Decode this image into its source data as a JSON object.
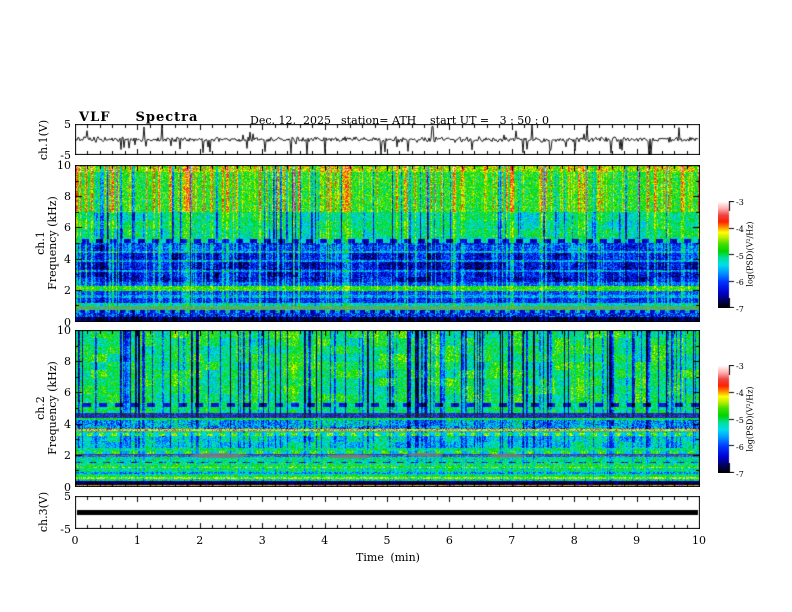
{
  "header": {
    "title": "VLF  Spectra",
    "date": "Dec. 12,  2025",
    "station": "station= ATH",
    "start_ut": "start UT =   3 : 50 : 0"
  },
  "time_axis": {
    "label": "Time  (min)",
    "range": [
      0,
      10
    ],
    "ticks": [
      "0",
      "1",
      "2",
      "3",
      "4",
      "5",
      "6",
      "7",
      "8",
      "9",
      "10"
    ],
    "minor_ticks_per_major": 5
  },
  "colorbar": {
    "label": "log(PSD)(V²/Hz)",
    "ticks": [
      "-3",
      "-4",
      "-5",
      "-6",
      "-7"
    ],
    "vmin": -7,
    "vmax": -3,
    "stops": [
      [
        0,
        "#000000"
      ],
      [
        0.05,
        "#000046"
      ],
      [
        0.14,
        "#0000cd"
      ],
      [
        0.24,
        "#0033ff"
      ],
      [
        0.33,
        "#0099ff"
      ],
      [
        0.4,
        "#00ddee"
      ],
      [
        0.47,
        "#00e09a"
      ],
      [
        0.53,
        "#00d400"
      ],
      [
        0.6,
        "#44e000"
      ],
      [
        0.66,
        "#c0ee00"
      ],
      [
        0.71,
        "#ffff00"
      ],
      [
        0.76,
        "#ff8800"
      ],
      [
        0.81,
        "#ff2200"
      ],
      [
        0.87,
        "#ee4444"
      ],
      [
        0.93,
        "#ffaaaa"
      ],
      [
        1,
        "#ffffff"
      ]
    ]
  },
  "chart_data": [
    {
      "type": "line",
      "name": "ch1_voltage_waveform",
      "ylabel": "ch.1(V)",
      "ylim": [
        -5,
        5
      ],
      "yticks": [
        "5",
        "-5"
      ],
      "xlim_min": [
        0,
        10
      ],
      "summary": "Broadband VLF noise trace: continuous ~±1 V fluctuations about 0 V with frequent impulsive sferic spikes reaching ±5 V across the whole 10 min record.",
      "synth": {
        "seed": 42,
        "noise_amp": 0.5,
        "spike_prob": 0.1,
        "spike_min": 1.5,
        "spike_max": 5.2,
        "down_bias": 0.6
      }
    },
    {
      "type": "heatmap",
      "name": "ch1_spectrogram",
      "ylabel": [
        "ch.1",
        "Frequency  (kHz)"
      ],
      "ylim": [
        0,
        10
      ],
      "yticks": [
        "10",
        "8",
        "6",
        "4",
        "2",
        "0"
      ],
      "xlim_min": [
        0,
        10
      ],
      "vmin": -7,
      "vmax": -3,
      "seed": 11,
      "summary": "Spectrogram of ch.1, 0-10 kHz over 10 min. Green background above 5.3 kHz with dense orange/red impulsive vertical streaks near 8-10 kHz and dark-blue streaks; quiet dark-blue band 2.5-5 kHz crossed by cyan sferic columns; bright green-yellow band near 2.0-2.3 kHz; blue 1.2-2.0 kHz; gray-olive band near 0.8-1.0 kHz; black band below 0.35 kHz. Dashed dark line near 5.1 kHz.",
      "streaks": {
        "up_prob": 0.22,
        "up_min": 0.3,
        "up_max": 1.2,
        "dn_prob": 0.1,
        "dn_min": 0.4,
        "dn_max": 1.4
      },
      "bands": [
        {
          "f": [
            9.55,
            10.01
          ],
          "b": -4.45,
          "n": 0.5,
          "up": 1.0,
          "dn": 0.8
        },
        {
          "f": [
            7.0,
            9.55
          ],
          "b": -4.8,
          "n": 0.45,
          "up": 1.0,
          "dn": 0.9
        },
        {
          "f": [
            5.3,
            7.0
          ],
          "b": -5.15,
          "n": 0.4,
          "up": 0.6,
          "dn": 1.0,
          "pa": 0.25
        },
        {
          "f": [
            5.05,
            5.3
          ],
          "b": -5.3,
          "n": 0.3,
          "up": 0.5,
          "dn": 0.5,
          "dl": 7,
          "da": -6.5
        },
        {
          "f": [
            4.55,
            5.05
          ],
          "b": -6.05,
          "n": 0.5,
          "up": 0.85,
          "dn": 0.3,
          "pa": 0.3
        },
        {
          "f": [
            4.42,
            4.55
          ],
          "b": -5.6,
          "n": 0.4,
          "up": 0.85,
          "dn": 0.3
        },
        {
          "f": [
            3.95,
            4.42
          ],
          "b": -6.3,
          "n": 0.5,
          "up": 0.85,
          "dn": 0.3,
          "pa": 0.3
        },
        {
          "f": [
            3.85,
            3.95
          ],
          "b": -5.7,
          "n": 0.4,
          "up": 0.85,
          "dn": 0.3
        },
        {
          "f": [
            3.3,
            3.85
          ],
          "b": -6.4,
          "n": 0.5,
          "up": 0.85,
          "dn": 0.3,
          "pa": 0.3
        },
        {
          "f": [
            3.2,
            3.3
          ],
          "b": -5.75,
          "n": 0.4,
          "up": 0.85,
          "dn": 0.3
        },
        {
          "f": [
            2.55,
            3.2
          ],
          "b": -6.35,
          "n": 0.5,
          "up": 0.85,
          "dn": 0.3,
          "pa": 0.3
        },
        {
          "f": [
            2.3,
            2.55
          ],
          "b": -5.9,
          "n": 0.45,
          "up": 0.8,
          "dn": 0.3
        },
        {
          "f": [
            2.0,
            2.3
          ],
          "b": -4.75,
          "n": 0.4,
          "up": 0.3,
          "dn": 0.3
        },
        {
          "f": [
            1.7,
            2.0
          ],
          "b": -6.0,
          "n": 0.45,
          "up": 0.7,
          "dn": 0.3
        },
        {
          "f": [
            1.55,
            1.7
          ],
          "b": -5.6,
          "n": 0.45,
          "up": 0.6,
          "dn": 0.3
        },
        {
          "f": [
            1.2,
            1.55
          ],
          "b": -6.15,
          "n": 0.45,
          "up": 0.7,
          "dn": 0.3
        },
        {
          "f": [
            1.05,
            1.2
          ],
          "b": -5.35,
          "n": 0.4,
          "up": 0.5,
          "dn": 0.2
        },
        {
          "f": [
            0.78,
            1.05
          ],
          "b": -4.95,
          "n": 0.35,
          "up": 0.25,
          "dn": 0.2,
          "gy": 0.5
        },
        {
          "f": [
            0.55,
            0.78
          ],
          "b": -5.5,
          "n": 0.6,
          "up": 0.3,
          "dn": 0.3,
          "dl": 5,
          "da": -6.4
        },
        {
          "f": [
            0.35,
            0.55
          ],
          "b": -6.15,
          "n": 0.6,
          "up": 0.3,
          "dn": 0.3
        },
        {
          "f": [
            -0.01,
            0.35
          ],
          "b": -6.85,
          "n": 0.25,
          "up": 0.4,
          "dn": 0.1
        }
      ]
    },
    {
      "type": "heatmap",
      "name": "ch2_spectrogram",
      "ylabel": [
        "ch.2",
        "Frequency  (kHz)"
      ],
      "ylim": [
        0,
        10
      ],
      "yticks": [
        "10",
        "8",
        "6",
        "4",
        "2",
        "0"
      ],
      "xlim_min": [
        0,
        10
      ],
      "vmin": -7,
      "vmax": -3,
      "seed": 77,
      "summary": "Spectrogram of ch.2, 0-10 kHz over 10 min. Mostly green with cyan patches and many thin dark vertical streaks above 5.3 kHz; dashed dark line near 5.2 kHz; dark band 4.4-4.7 kHz; blue speckled band 3.7-4.3 kHz; orange-red line near 3.6 kHz and orange dashes near 3.3 kHz; cyan band 2.5-3.2 kHz; yellow-green band with dark dashes near 2.2 kHz; segmented gray double lines near 1.9-2.1 kHz; green with yellow speckle lines below 1.5 kHz; yellow line near 0.55 kHz; black band 0.1-0.4 kHz; dark-red line at the bottom edge.",
      "streaks": {
        "up_prob": 0.1,
        "up_min": 0.2,
        "up_max": 0.8,
        "dn_prob": 0.2,
        "dn_min": 0.5,
        "dn_max": 1.7
      },
      "bands": [
        {
          "f": [
            5.35,
            10.01
          ],
          "b": -5.0,
          "n": 0.42,
          "up": 0.35,
          "dn": 1.15,
          "pa": 0.35
        },
        {
          "f": [
            5.1,
            5.35
          ],
          "b": -5.15,
          "n": 0.35,
          "up": 0.3,
          "dn": 0.8,
          "dl": 8,
          "da": -6.3
        },
        {
          "f": [
            4.7,
            5.1
          ],
          "b": -5.05,
          "n": 0.35,
          "up": 0.3,
          "dn": 0.9,
          "pa": 0.25
        },
        {
          "f": [
            4.38,
            4.7
          ],
          "b": -6.35,
          "n": 0.5,
          "up": 0.3,
          "dn": 0.4,
          "gy": 0.25
        },
        {
          "f": [
            4.28,
            4.38
          ],
          "b": -4.9,
          "n": 0.35,
          "up": 0.2,
          "dn": 0.3
        },
        {
          "f": [
            3.72,
            4.28
          ],
          "b": -5.55,
          "n": 0.6,
          "up": 0.3,
          "dn": 0.5,
          "pa": 0.3
        },
        {
          "f": [
            3.55,
            3.72
          ],
          "b": -4.05,
          "n": 0.35,
          "up": 0.15,
          "dn": 0.2
        },
        {
          "f": [
            3.42,
            3.55
          ],
          "b": -5.3,
          "n": 0.4,
          "up": 0.25,
          "dn": 0.3
        },
        {
          "f": [
            3.25,
            3.42
          ],
          "b": -4.5,
          "n": 0.4,
          "up": 0.2,
          "dn": 0.25,
          "dl": 6,
          "da": -5.4
        },
        {
          "f": [
            2.5,
            3.25
          ],
          "b": -5.4,
          "n": 0.45,
          "up": 0.3,
          "dn": 0.55,
          "pa": 0.3
        },
        {
          "f": [
            2.32,
            2.5
          ],
          "b": -5.05,
          "n": 0.4,
          "up": 0.25,
          "dn": 0.3
        },
        {
          "f": [
            2.12,
            2.32
          ],
          "b": -4.7,
          "n": 0.45,
          "up": 0.25,
          "dn": 0.25,
          "dl": 9,
          "da": -5.5
        },
        {
          "f": [
            2.02,
            2.12
          ],
          "b": -6.55,
          "n": 0.5,
          "up": 0.2,
          "dn": 0.2,
          "gy": 0.45
        },
        {
          "f": [
            1.88,
            2.02
          ],
          "b": -5.9,
          "n": 0.5,
          "up": 0.2,
          "dn": 0.2,
          "gy": 0.35
        },
        {
          "f": [
            1.62,
            1.88
          ],
          "b": -5.15,
          "n": 0.45,
          "up": 0.3,
          "dn": 0.3
        },
        {
          "f": [
            1.5,
            1.62
          ],
          "b": -6.2,
          "n": 0.5,
          "up": 0.25,
          "dn": 0.2,
          "dl": 7,
          "da": -5.2
        },
        {
          "f": [
            1.3,
            1.5
          ],
          "b": -4.95,
          "n": 0.5,
          "up": 0.25,
          "dn": 0.25
        },
        {
          "f": [
            1.18,
            1.3
          ],
          "b": -4.6,
          "n": 0.5,
          "up": 0.2,
          "dn": 0.2
        },
        {
          "f": [
            0.95,
            1.18
          ],
          "b": -5.1,
          "n": 0.5,
          "up": 0.25,
          "dn": 0.25
        },
        {
          "f": [
            0.8,
            0.95
          ],
          "b": -5.6,
          "n": 0.5,
          "up": 0.25,
          "dn": 0.25
        },
        {
          "f": [
            0.62,
            0.8
          ],
          "b": -5.05,
          "n": 0.45,
          "up": 0.2,
          "dn": 0.2
        },
        {
          "f": [
            0.5,
            0.62
          ],
          "b": -4.4,
          "n": 0.35,
          "up": 0.15,
          "dn": 0.15
        },
        {
          "f": [
            0.38,
            0.5
          ],
          "b": -5.35,
          "n": 0.45,
          "up": 0.2,
          "dn": 0.2
        },
        {
          "f": [
            0.1,
            0.38
          ],
          "b": -6.8,
          "n": 0.3,
          "up": 0.3,
          "dn": 0.1
        },
        {
          "f": [
            -0.01,
            0.1
          ],
          "b": -4.05,
          "n": 0.3,
          "up": 0.1,
          "dn": 0.1,
          "gy": 0.35
        }
      ],
      "gray_patches": [
        {
          "t": 2.3,
          "f": 2.0,
          "rt": 0.45,
          "rf": 0.16
        },
        {
          "t": 4.4,
          "f": 1.95,
          "rt": 0.35,
          "rf": 0.14
        },
        {
          "t": 5.6,
          "f": 2.05,
          "rt": 0.28,
          "rf": 0.12
        },
        {
          "t": 6.9,
          "f": 2.0,
          "rt": 0.3,
          "rf": 0.13
        }
      ]
    },
    {
      "type": "line",
      "name": "ch3_voltage_waveform",
      "ylabel": "ch.3(V)",
      "ylim": [
        -5,
        5
      ],
      "yticks": [
        "5",
        "-5"
      ],
      "xlim_min": [
        0,
        10
      ],
      "constant_value": 0,
      "summary": "Flat thick black line at 0 V for the full 10 min (no signal on ch.3)."
    }
  ]
}
